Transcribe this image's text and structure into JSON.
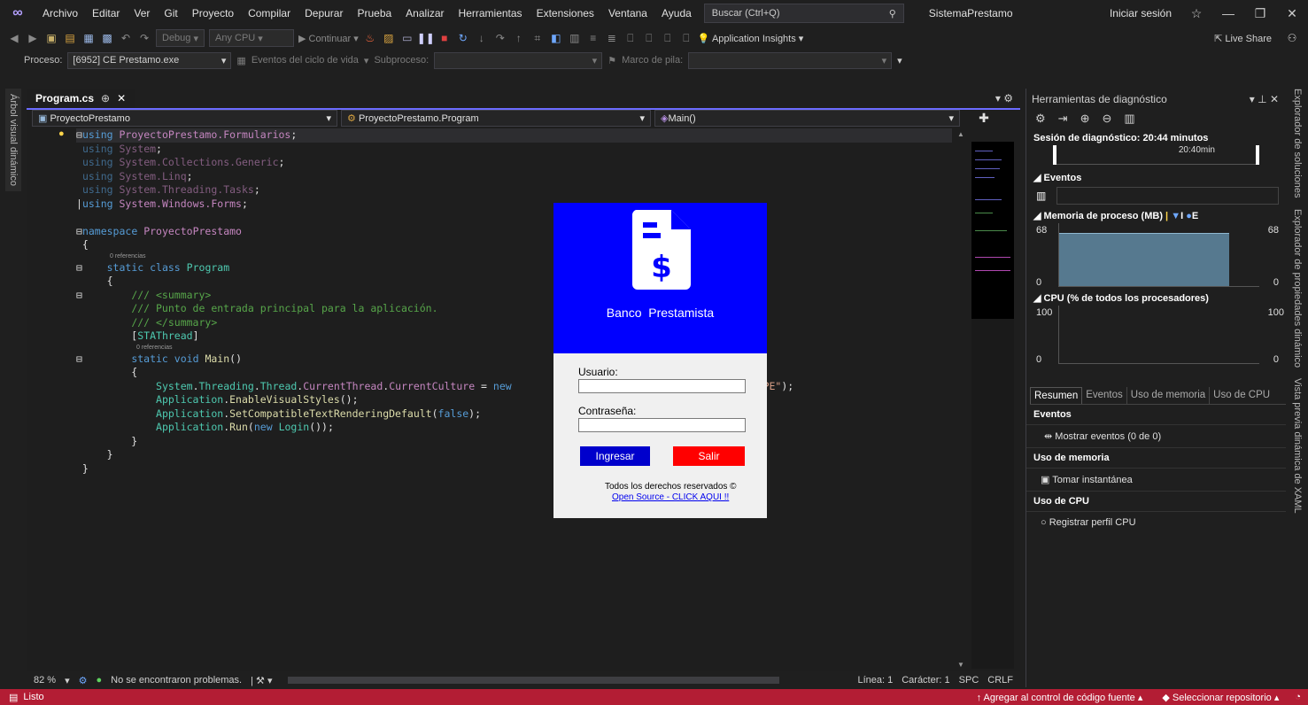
{
  "menu": {
    "items": [
      "Archivo",
      "Editar",
      "Ver",
      "Git",
      "Proyecto",
      "Compilar",
      "Depurar",
      "Prueba",
      "Analizar",
      "Herramientas",
      "Extensiones",
      "Ventana",
      "Ayuda"
    ],
    "search_placeholder": "Buscar (Ctrl+Q)",
    "solution_name": "SistemaPrestamo",
    "signin": "Iniciar sesión"
  },
  "toolbar": {
    "config": "Debug",
    "platform": "Any CPU",
    "continue": "Continuar",
    "app_insights": "Application Insights",
    "live_share": "Live Share"
  },
  "procbar": {
    "proceso_label": "Proceso:",
    "proceso_value": "[6952] CE Prestamo.exe",
    "eventos": "Eventos del ciclo de vida",
    "subproceso": "Subproceso:",
    "marco": "Marco de pila:"
  },
  "left_vtab": "Árbol visual dinámico",
  "editor": {
    "tab_name": "Program.cs",
    "nav_project": "ProyectoPrestamo",
    "nav_class": "ProyectoPrestamo.Program",
    "nav_member": "Main()",
    "ref_label": "0 referencias"
  },
  "edstatus": {
    "zoom": "82 %",
    "problems": "No se encontraron problemas.",
    "line": "Línea: 1",
    "char": "Carácter: 1",
    "spc": "SPC",
    "crlf": "CRLF"
  },
  "statusbar": {
    "ready": "Listo",
    "add_source": "Agregar al control de código fuente",
    "select_repo": "Seleccionar repositorio"
  },
  "diag": {
    "title": "Herramientas de diagnóstico",
    "session": "Sesión de diagnóstico: 20:44 minutos",
    "timeline_label": "20:40min",
    "eventos": "Eventos",
    "memoria": "Memoria de proceso (MB)",
    "mem_max": "68",
    "mem_min": "0",
    "cpu": "CPU (% de todos los procesadores)",
    "cpu_max": "100",
    "cpu_min": "0",
    "tabs": [
      "Resumen",
      "Eventos",
      "Uso de memoria",
      "Uso de CPU"
    ],
    "sec_eventos": "Eventos",
    "mostrar_eventos": "Mostrar eventos (0 de 0)",
    "sec_memoria": "Uso de memoria",
    "tomar": "Tomar instantánea",
    "sec_cpu": "Uso de CPU",
    "registrar": "Registrar perfil CPU",
    "legend_i": "I",
    "legend_e": "E"
  },
  "right_vtabs": [
    "Explorador de soluciones",
    "Explorador de propiedades dinámico",
    "Vista previa dinámica de XAML"
  ],
  "login": {
    "bank_name": "Banco  Prestamista",
    "usuario": "Usuario:",
    "contrasena": "Contraseña:",
    "ingresar": "Ingresar",
    "salir": "Salir",
    "rights": "Todos los derechos reservados ©",
    "link": "Open Source - CLICK AQUI !!",
    "colors": {
      "header": "#0000ff",
      "ingresar": "#0000cc",
      "salir": "#ff0000"
    }
  }
}
